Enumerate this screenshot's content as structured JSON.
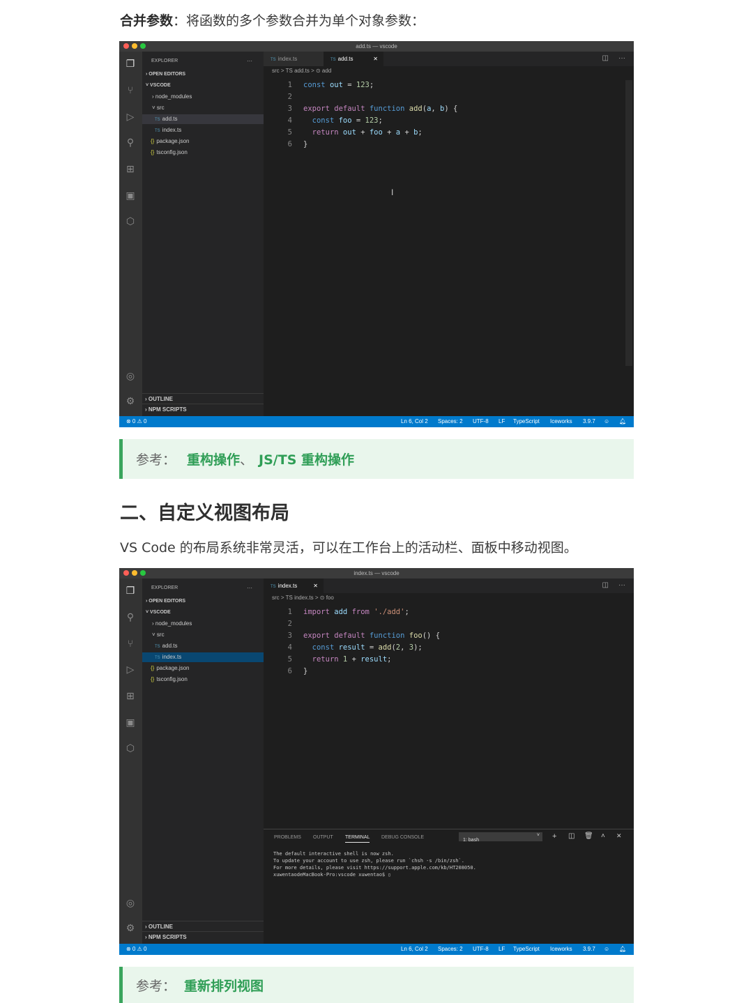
{
  "intro": {
    "bold": "合并参数",
    "text": "：将函数的多个参数合并为单个对象参数："
  },
  "note1": {
    "label": "参考：",
    "link1": "重构操作",
    "sep": "、",
    "link2": "JS/TS 重构操作"
  },
  "heading": "二、自定义视图布局",
  "para2": "VS Code 的布局系统非常灵活，可以在工作台上的活动栏、面板中移动视图。",
  "note2": {
    "label": "参考：",
    "link1": "重新排列视图"
  },
  "shot1": {
    "title": "add.ts — vscode",
    "explorer_title": "EXPLORER",
    "more": "···",
    "open_editors": "OPEN EDITORS",
    "workspace": "VSCODE",
    "tree": [
      "node_modules",
      "src",
      "add.ts",
      "index.ts",
      "package.json",
      "tsconfig.json"
    ],
    "tabs": [
      "index.ts",
      "add.ts"
    ],
    "breadcrumb": "src  >  TS add.ts  >  ⊙ add",
    "lines": [
      "1",
      "2",
      "3",
      "4",
      "5",
      "6"
    ],
    "outline": "OUTLINE",
    "npm": "NPM SCRIPTS",
    "status_left": "⊗ 0 ⚠ 0",
    "status_items": [
      "Ln 6, Col 2",
      "Spaces: 2",
      "UTF-8",
      "LF",
      "TypeScript",
      "Iceworks",
      "3.9.7"
    ]
  },
  "shot2": {
    "title": "index.ts — vscode",
    "explorer_title": "EXPLORER",
    "more": "···",
    "open_editors": "OPEN EDITORS",
    "workspace": "VSCODE",
    "tree": [
      "node_modules",
      "src",
      "add.ts",
      "index.ts",
      "package.json",
      "tsconfig.json"
    ],
    "tabs": [
      "index.ts"
    ],
    "breadcrumb": "src  >  TS index.ts  >  ⊙ foo",
    "lines": [
      "1",
      "2",
      "3",
      "4",
      "5",
      "6"
    ],
    "panel_tabs": [
      "PROBLEMS",
      "OUTPUT",
      "TERMINAL",
      "DEBUG CONSOLE"
    ],
    "terminal_select": "1: bash",
    "terminal": "The default interactive shell is now zsh.\nTo update your account to use zsh, please run `chsh -s /bin/zsh`.\nFor more details, please visit https://support.apple.com/kb/HT208050.\nxuwentaodeMacBook-Pro:vscode xuwentao$ ▯",
    "outline": "OUTLINE",
    "npm": "NPM SCRIPTS",
    "status_left": "⊗ 0 ⚠ 0",
    "status_items": [
      "Ln 6, Col 2",
      "Spaces: 2",
      "UTF-8",
      "LF",
      "TypeScript",
      "Iceworks",
      "3.9.7"
    ]
  },
  "colors": {
    "accent": "#2f9e56",
    "status": "#007acc"
  }
}
